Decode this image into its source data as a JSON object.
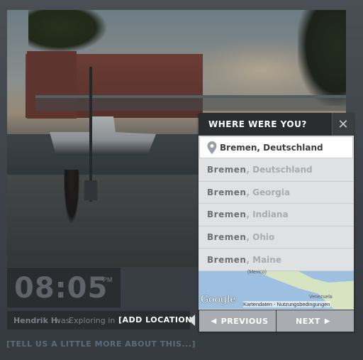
{
  "time": {
    "value": "08:05",
    "ampm": "PM"
  },
  "info": {
    "name": "Hendrik H.",
    "was": "was",
    "activity": "Exploring in",
    "add_location": "[ADD LOCATION]"
  },
  "tell_more": "[TELL US A LITTLE MORE ABOUT THIS...]",
  "popup": {
    "title": "WHERE WERE YOU?",
    "close_icon": "close-icon",
    "search_value": "Bremen, Deutschland",
    "results": [
      {
        "city": "Bremen",
        "region": ", Deutschland"
      },
      {
        "city": "Bremen",
        "region": ", Georgia"
      },
      {
        "city": "Bremen",
        "region": ", Indiana"
      },
      {
        "city": "Bremen",
        "region": ", Ohio"
      },
      {
        "city": "Bremen",
        "region": ", Maine"
      }
    ],
    "map": {
      "label_top": "(Mexico)",
      "label_venezuela": "Venezuela",
      "logo": "Google",
      "credit": "Kartendaten - Nutzungsbedingungen"
    },
    "prev_label": "PREVIOUS",
    "next_label": "NEXT"
  }
}
